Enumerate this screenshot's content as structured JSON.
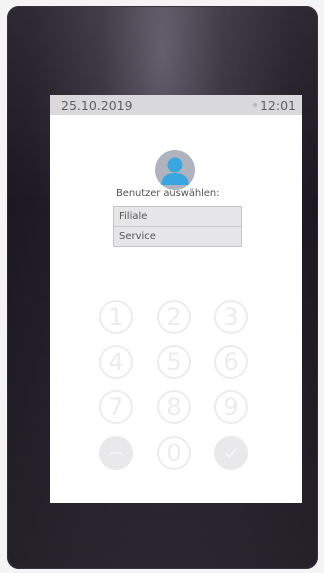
{
  "status": {
    "date": "25.10.2019",
    "time": "12:01"
  },
  "login": {
    "avatar_icon": "user-icon",
    "prompt": "Benutzer auswählen:",
    "users": [
      "Filiale",
      "Service"
    ]
  },
  "keypad": {
    "keys": [
      "1",
      "2",
      "3",
      "4",
      "5",
      "6",
      "7",
      "8",
      "9",
      "0"
    ],
    "cancel_icon": "cancel-icon",
    "confirm_icon": "checkmark-icon"
  },
  "colors": {
    "device": "#1f1a24",
    "status_bar": "#d9d9dc",
    "avatar_head": "#3aa6e0",
    "key_outline": "#ececec"
  }
}
